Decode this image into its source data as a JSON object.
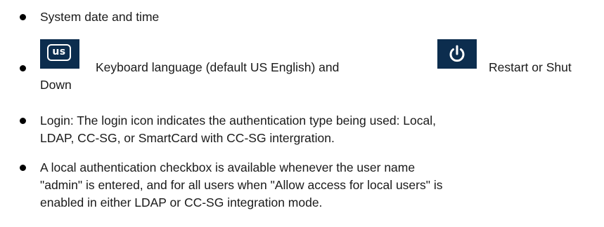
{
  "bullets": [
    {
      "text": "System date and time"
    },
    {
      "us_icon_label": "us",
      "text_before": "Keyboard language (default US English) and",
      "text_after_first": "Restart or Shut",
      "text_after_second": "Down"
    },
    {
      "line1": "Login: The login icon indicates the authentication type being used: Local,",
      "line2": "LDAP, CC-SG, or SmartCard with CC-SG intergration."
    },
    {
      "line1": "A local authentication checkbox is available whenever the user name",
      "line2": "\"admin\" is entered, and for all users when \"Allow access for local users\" is",
      "line3": "enabled in either LDAP or CC-SG integration mode."
    }
  ],
  "colors": {
    "icon_background": "#0c2d4e",
    "icon_foreground": "#ffffff",
    "text": "#1a1a1a",
    "bullet": "#000000"
  },
  "icons": [
    "keyboard-language-us-icon",
    "power-icon"
  ]
}
